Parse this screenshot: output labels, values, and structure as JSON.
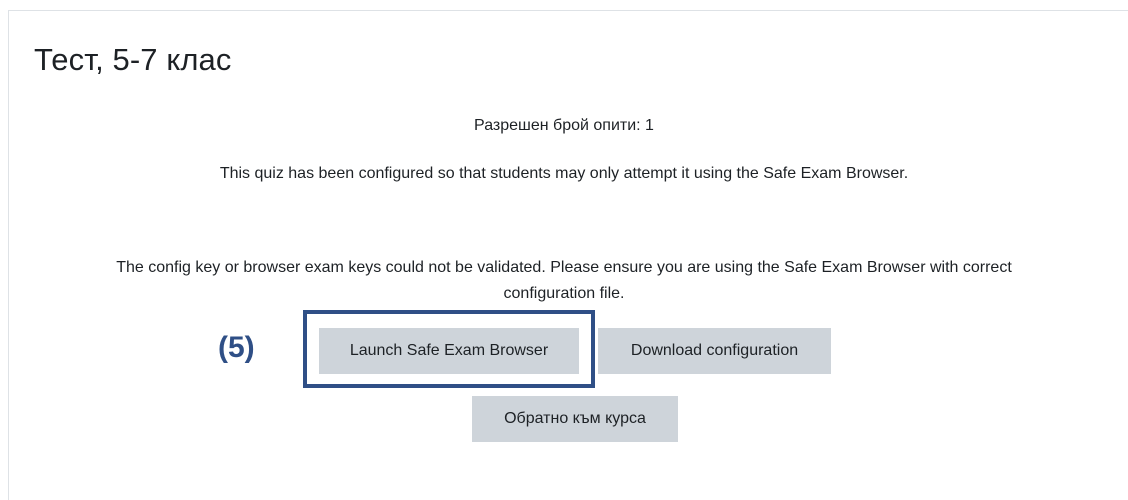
{
  "page": {
    "title": "Тест, 5-7 клас"
  },
  "quiz_info": {
    "attempts_allowed": "Разрешен брой опити: 1",
    "seb_required": "This quiz has been configured so that students may only attempt it using the Safe Exam Browser.",
    "error_line1": "The config key or browser exam keys could not be validated. Please ensure you are using the Safe Exam Browser with correct",
    "error_line2": "configuration file."
  },
  "actions": {
    "launch_label": "Launch Safe Exam Browser",
    "download_label": "Download configuration",
    "back_label": "Обратно към курса"
  },
  "annotation": {
    "label": "(5)",
    "color": "#2f4f86"
  },
  "colors": {
    "button_bg": "#ced4da",
    "text": "#1d2125"
  }
}
